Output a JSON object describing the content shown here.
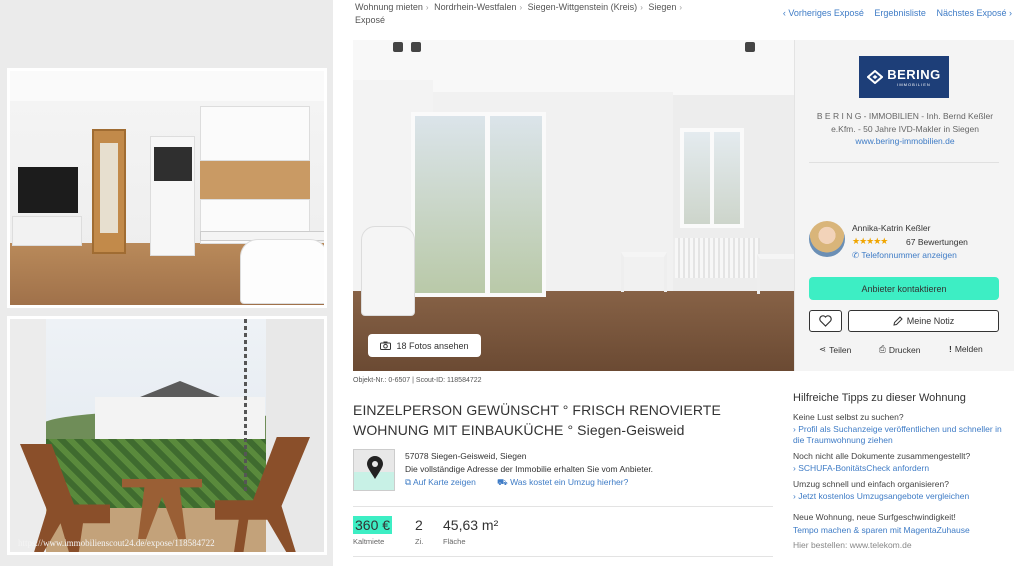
{
  "breadcrumb": {
    "items": [
      "Wohnung mieten",
      "Nordrhein-Westfalen",
      "Siegen-Wittgenstein (Kreis)",
      "Siegen",
      "Exposé"
    ]
  },
  "top_nav": {
    "prev": "‹ Vorheriges Exposé",
    "results": "Ergebnisliste",
    "next": "Nächstes Exposé ›"
  },
  "gallery": {
    "watermark": "https://www.immobilienscout24.de/expose/118584722"
  },
  "photos_button": {
    "label": "18 Fotos ansehen",
    "icon": "camera-icon"
  },
  "agent": {
    "logo_text": "BERING",
    "logo_subtext": "IMMOBILIEN",
    "company_line1": "B E R I N G - IMMOBILIEN - Inh. Bernd Keßler",
    "company_line2": "e.Kfm. - 50 Jahre IVD-Makler in Siegen",
    "website": "www.bering-immobilien.de",
    "name": "Annika-Katrin Keßler",
    "stars": "★★★★★",
    "rating": 5,
    "reviews": "67 Bewertungen",
    "phone_link": "Telefonnummer anzeigen",
    "contact_button": "Anbieter kontaktieren",
    "note_button": "Meine Notiz",
    "share": "Teilen",
    "print": "Drucken",
    "report": "Melden"
  },
  "listing": {
    "ids": "Objekt-Nr.: 0-6507 | Scout-ID: 118584722",
    "title_line1": "EINZELPERSON GEWÜNSCHT ° FRISCH RENOVIERTE",
    "title_line2": "WOHNUNG MIT EINBAUKÜCHE ° Siegen-Geisweid",
    "address": "57078 Siegen-Geisweid, Siegen",
    "address_note": "Die vollständige Adresse der Immobilie erhalten Sie vom Anbieter.",
    "map_link": "Auf Karte zeigen",
    "move_cost_link": "Was kostet ein Umzug hierher?",
    "price": "360 €",
    "price_label": "Kaltmiete",
    "rooms": "2",
    "rooms_label": "Zi.",
    "area": "45,63 m²",
    "area_label": "Fläche"
  },
  "tips": {
    "heading": "Hilfreiche Tipps zu dieser Wohnung",
    "q1": "Keine Lust selbst zu suchen?",
    "a1": "› Profil als Suchanzeige veröffentlichen und schneller in die Traumwohnung ziehen",
    "q2": "Noch nicht alle Dokumente zusammengestellt?",
    "a2": "› SCHUFA-BonitätsCheck anfordern",
    "q3": "Umzug schnell und einfach organisieren?",
    "a3": "› Jetzt kostenlos Umzugsangebote vergleichen",
    "q4": "Neue Wohnung, neue Surfgeschwindigkeit!",
    "a4": "Tempo machen & sparen mit MagentaZuhause",
    "note": "Hier bestellen: www.telekom.de"
  },
  "colors": {
    "accent": "#3deec4",
    "link": "#3f7cc6",
    "brand": "#1d3e78",
    "stars": "#f0a500"
  }
}
